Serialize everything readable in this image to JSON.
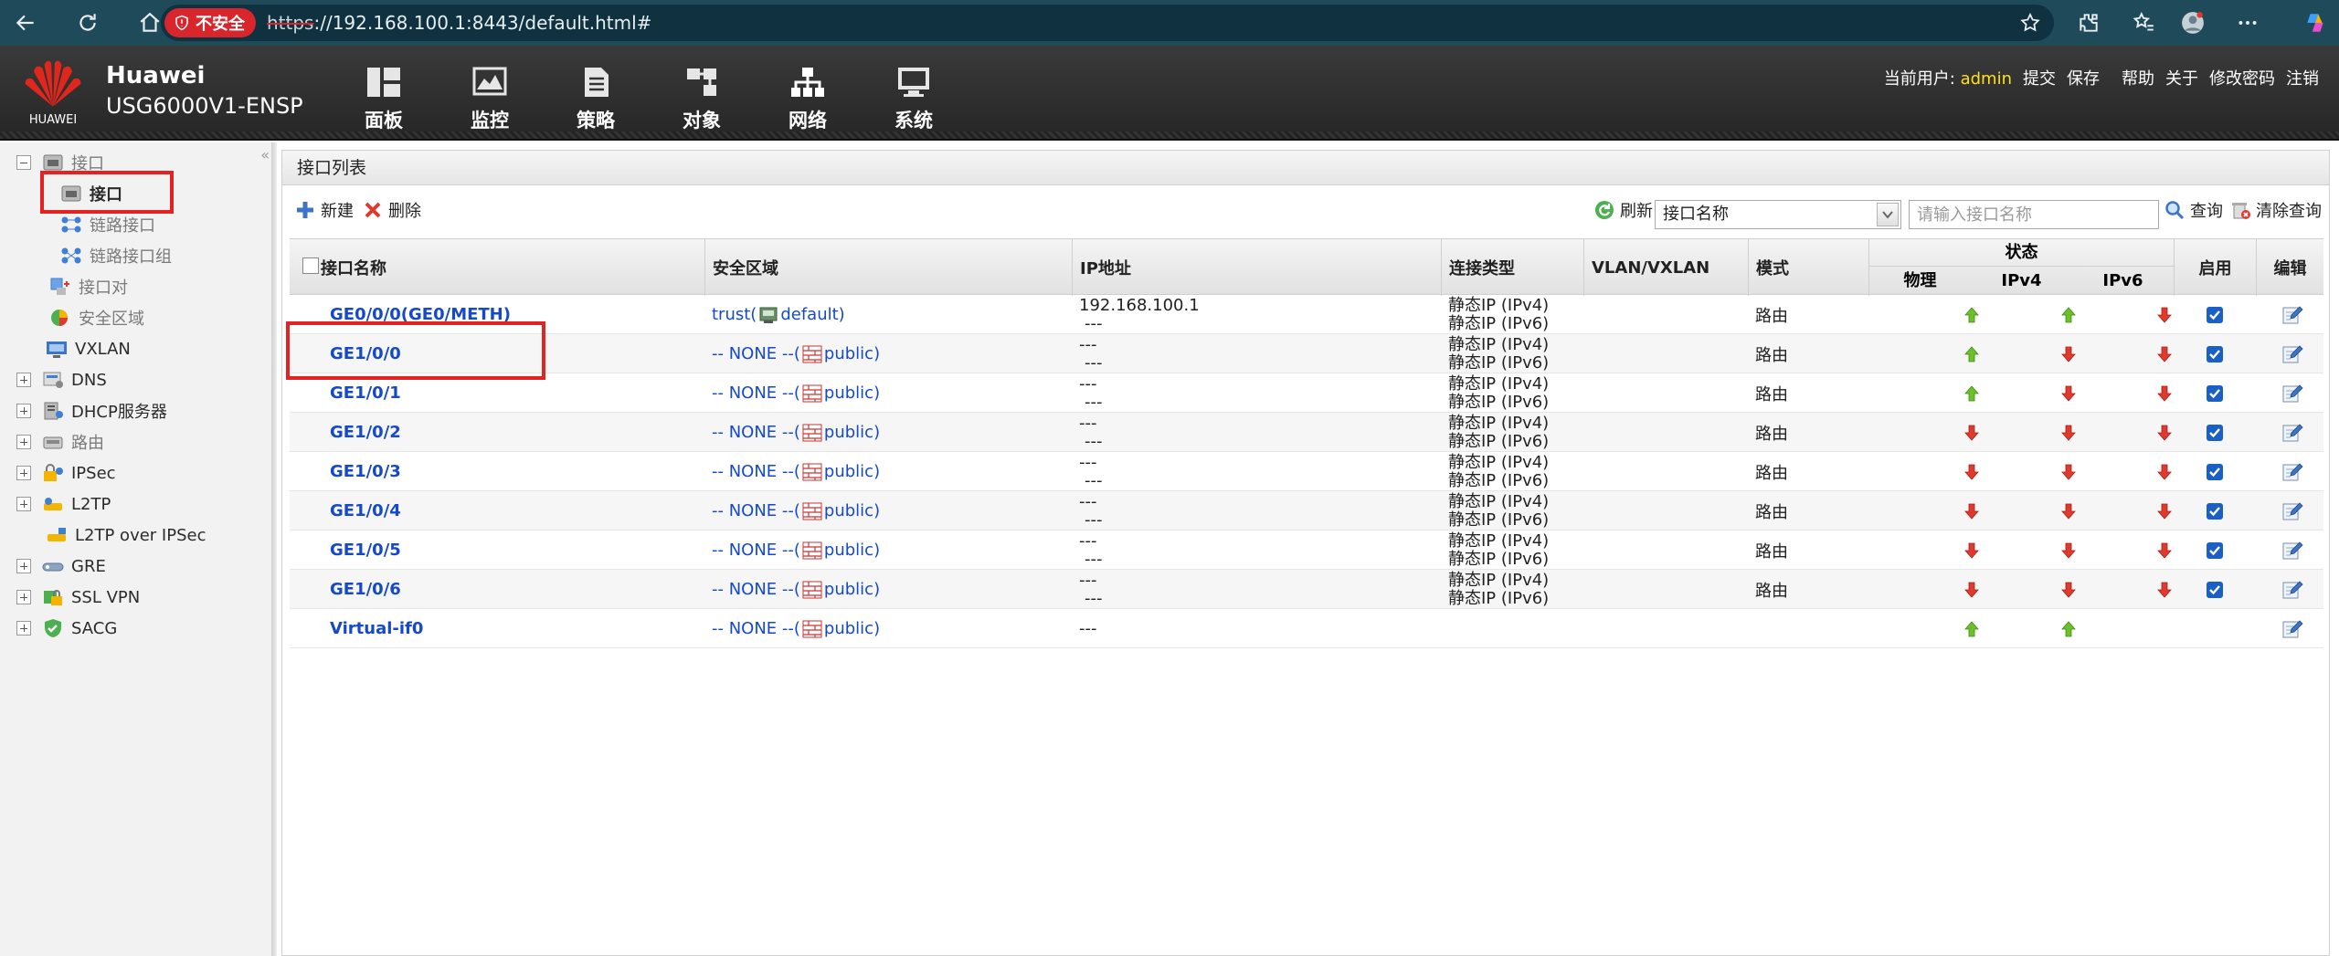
{
  "browser": {
    "security_label": "不安全",
    "url_protocol": "https",
    "url_rest": "://192.168.100.1:8443/default.html#"
  },
  "header": {
    "logo_text": "HUAWEI",
    "brand_line1": "Huawei",
    "brand_line2": "USG6000V1-ENSP",
    "nav": [
      {
        "label": "面板",
        "icon": "dashboard-icon"
      },
      {
        "label": "监控",
        "icon": "monitor-icon"
      },
      {
        "label": "策略",
        "icon": "policy-icon"
      },
      {
        "label": "对象",
        "icon": "object-icon"
      },
      {
        "label": "网络",
        "icon": "network-icon"
      },
      {
        "label": "系统",
        "icon": "system-icon"
      }
    ],
    "user_label": "当前用户:",
    "user_name": "admin",
    "actions": [
      "提交",
      "保存",
      "帮助",
      "关于",
      "修改密码",
      "注销"
    ]
  },
  "sidebar": {
    "items": [
      {
        "label": "接口",
        "level": 0,
        "expander": "minus",
        "icon": "interface-icon"
      },
      {
        "label": "接口",
        "level": 1,
        "icon": "interface-icon",
        "selected": true
      },
      {
        "label": "链路接口",
        "level": 1,
        "icon": "link-interface-icon"
      },
      {
        "label": "链路接口组",
        "level": 1,
        "icon": "link-group-icon"
      },
      {
        "label": "接口对",
        "level": 0,
        "icon": "interface-pair-icon"
      },
      {
        "label": "安全区域",
        "level": 0,
        "icon": "security-zone-icon"
      },
      {
        "label": "VXLAN",
        "level": 0,
        "icon": "vxlan-icon"
      },
      {
        "label": "DNS",
        "level": 0,
        "expander": "plus",
        "icon": "dns-icon"
      },
      {
        "label": "DHCP服务器",
        "level": 0,
        "expander": "plus",
        "icon": "dhcp-icon"
      },
      {
        "label": "路由",
        "level": 0,
        "expander": "plus",
        "icon": "route-icon"
      },
      {
        "label": "IPSec",
        "level": 0,
        "expander": "plus",
        "icon": "ipsec-icon"
      },
      {
        "label": "L2TP",
        "level": 0,
        "expander": "plus",
        "icon": "l2tp-icon"
      },
      {
        "label": "L2TP over IPSec",
        "level": 0,
        "icon": "l2tp-ipsec-icon"
      },
      {
        "label": "GRE",
        "level": 0,
        "expander": "plus",
        "icon": "gre-icon"
      },
      {
        "label": "SSL VPN",
        "level": 0,
        "expander": "plus",
        "icon": "sslvpn-icon"
      },
      {
        "label": "SACG",
        "level": 0,
        "expander": "plus",
        "icon": "sacg-icon"
      }
    ]
  },
  "panel": {
    "title": "接口列表",
    "new_label": "新建",
    "delete_label": "删除",
    "refresh_label": "刷新",
    "search_field_selected": "接口名称",
    "search_placeholder": "请输入接口名称",
    "query_label": "查询",
    "clear_label": "清除查询"
  },
  "table": {
    "headers": {
      "name": "接口名称",
      "zone": "安全区域",
      "ip": "IP地址",
      "conn": "连接类型",
      "vlan": "VLAN/VXLAN",
      "mode": "模式",
      "state": "状态",
      "phys": "物理",
      "ipv4": "IPv4",
      "ipv6": "IPv6",
      "enable": "启用",
      "edit": "编辑"
    },
    "rows": [
      {
        "name": "GE0/0/0(GE0/METH)",
        "zone_prefix": "trust(",
        "zone_suffix": "default)",
        "zone_icon": "trust-zone-icon",
        "ip1": "192.168.100.1",
        "ip2": "---",
        "conn1": "静态IP (IPv4)",
        "conn2": "静态IP (IPv6)",
        "mode": "路由",
        "phys": "up",
        "ipv4": "up",
        "ipv6": "down",
        "enabled": true
      },
      {
        "name": "GE1/0/0",
        "zone_prefix": "-- NONE --(",
        "zone_suffix": "public)",
        "zone_icon": "none-zone-icon",
        "ip1": "---",
        "ip2": "---",
        "conn1": "静态IP (IPv4)",
        "conn2": "静态IP (IPv6)",
        "mode": "路由",
        "phys": "up",
        "ipv4": "down",
        "ipv6": "down",
        "enabled": true
      },
      {
        "name": "GE1/0/1",
        "zone_prefix": "-- NONE --(",
        "zone_suffix": "public)",
        "zone_icon": "none-zone-icon",
        "ip1": "---",
        "ip2": "---",
        "conn1": "静态IP (IPv4)",
        "conn2": "静态IP (IPv6)",
        "mode": "路由",
        "phys": "up",
        "ipv4": "down",
        "ipv6": "down",
        "enabled": true
      },
      {
        "name": "GE1/0/2",
        "zone_prefix": "-- NONE --(",
        "zone_suffix": "public)",
        "zone_icon": "none-zone-icon",
        "ip1": "---",
        "ip2": "---",
        "conn1": "静态IP (IPv4)",
        "conn2": "静态IP (IPv6)",
        "mode": "路由",
        "phys": "down",
        "ipv4": "down",
        "ipv6": "down",
        "enabled": true
      },
      {
        "name": "GE1/0/3",
        "zone_prefix": "-- NONE --(",
        "zone_suffix": "public)",
        "zone_icon": "none-zone-icon",
        "ip1": "---",
        "ip2": "---",
        "conn1": "静态IP (IPv4)",
        "conn2": "静态IP (IPv6)",
        "mode": "路由",
        "phys": "down",
        "ipv4": "down",
        "ipv6": "down",
        "enabled": true
      },
      {
        "name": "GE1/0/4",
        "zone_prefix": "-- NONE --(",
        "zone_suffix": "public)",
        "zone_icon": "none-zone-icon",
        "ip1": "---",
        "ip2": "---",
        "conn1": "静态IP (IPv4)",
        "conn2": "静态IP (IPv6)",
        "mode": "路由",
        "phys": "down",
        "ipv4": "down",
        "ipv6": "down",
        "enabled": true
      },
      {
        "name": "GE1/0/5",
        "zone_prefix": "-- NONE --(",
        "zone_suffix": "public)",
        "zone_icon": "none-zone-icon",
        "ip1": "---",
        "ip2": "---",
        "conn1": "静态IP (IPv4)",
        "conn2": "静态IP (IPv6)",
        "mode": "路由",
        "phys": "down",
        "ipv4": "down",
        "ipv6": "down",
        "enabled": true
      },
      {
        "name": "GE1/0/6",
        "zone_prefix": "-- NONE --(",
        "zone_suffix": "public)",
        "zone_icon": "none-zone-icon",
        "ip1": "---",
        "ip2": "---",
        "conn1": "静态IP (IPv4)",
        "conn2": "静态IP (IPv6)",
        "mode": "路由",
        "phys": "down",
        "ipv4": "down",
        "ipv6": "down",
        "enabled": true
      },
      {
        "name": "Virtual-if0",
        "zone_prefix": "-- NONE --(",
        "zone_suffix": "public)",
        "zone_icon": "none-zone-icon",
        "ip1": "---",
        "ip2": "",
        "conn1": "",
        "conn2": "",
        "mode": "",
        "phys": "up",
        "ipv4": "up",
        "ipv6": "",
        "enabled": null
      }
    ]
  },
  "colors": {
    "browser_bar": "#1f4a5a",
    "link_blue": "#1549c9",
    "status_up": "#6cc02a",
    "status_down": "#e03a2f",
    "highlight_red": "#e52222",
    "user_name": "#ffe11a"
  }
}
